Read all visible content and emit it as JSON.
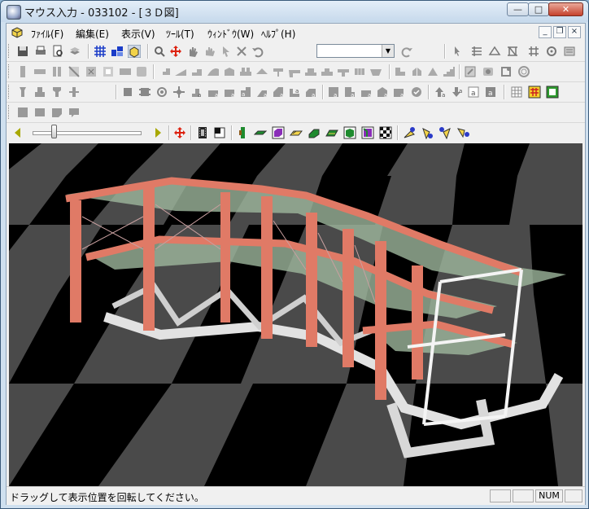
{
  "window": {
    "title": "マウス入力 - 033102 - [３Ｄ図]"
  },
  "menu": {
    "items": [
      "ﾌｧｲﾙ(F)",
      "編集(E)",
      "表示(V)",
      "ﾂｰﾙ(T)",
      "ｳｨﾝﾄﾞｳ(W)",
      "ﾍﾙﾌﾟ(H)"
    ]
  },
  "toolbar": {
    "combo_value": ""
  },
  "status": {
    "message": "ドラッグして表示位置を回転してください。",
    "num_indicator": "NUM"
  },
  "colors": {
    "column": "#e07a66",
    "slab": "#9eb79c",
    "foundation": "#e2e2e2",
    "checker_dark": "#000000",
    "checker_light": "#4a4a4a"
  }
}
